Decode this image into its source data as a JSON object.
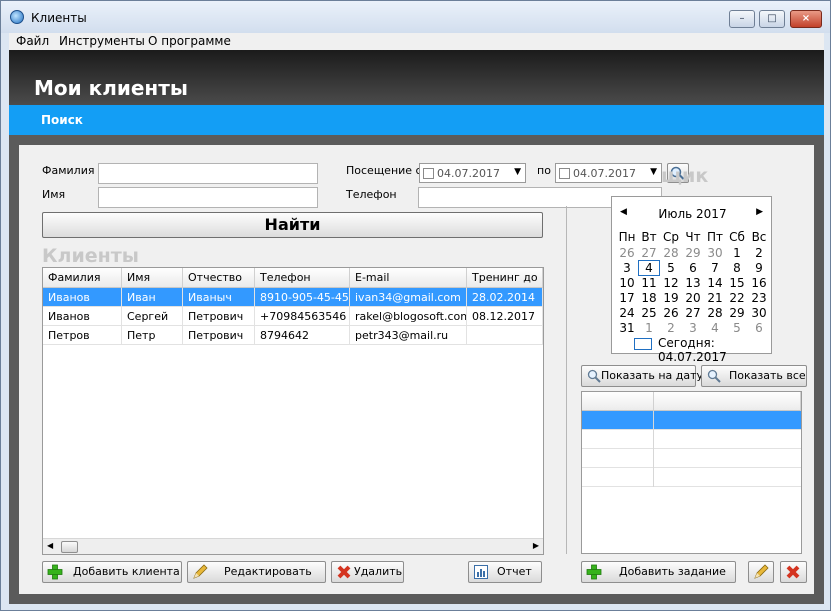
{
  "window": {
    "title": "Клиенты",
    "min": "–",
    "max": "□",
    "close": "×"
  },
  "menu": [
    "Файл",
    "Инструменты",
    "О программе"
  ],
  "header": {
    "title": "Мои клиенты",
    "tab": "Поиск"
  },
  "search": {
    "surname_label": "Фамилия",
    "name_label": "Имя",
    "visit_from_label": "Посещение с",
    "visit_to_label": "по",
    "phone_label": "Телефон",
    "date_from": "04.07.2017",
    "date_to": "04.07.2017",
    "find_button": "Найти"
  },
  "clients_section_title": "Клиенты",
  "scheduler_section_title": "щик",
  "table": {
    "columns": [
      "Фамилия",
      "Имя",
      "Отчество",
      "Телефон",
      "E-mail",
      "Тренинг до"
    ],
    "rows": [
      [
        "Иванов",
        "Иван",
        "Иваныч",
        "8910-905-45-45",
        "ivan34@gmail.com",
        "28.02.2014"
      ],
      [
        "Иванов",
        "Сергей",
        "Петрович",
        "+70984563546",
        "rakel@blogosoft.com",
        "08.12.2017"
      ],
      [
        "Петров",
        "Петр",
        "Петрович",
        "8794642",
        "petr343@mail.ru",
        ""
      ]
    ]
  },
  "buttons": {
    "add_client": "Добавить клиента",
    "edit": "Редактировать",
    "delete": "Удалить",
    "report": "Отчет",
    "show_on_date": "Показать на дату",
    "show_all": "Показать все",
    "add_task": "Добавить задание"
  },
  "calendar": {
    "month": "Июль 2017",
    "weekdays": [
      "Пн",
      "Вт",
      "Ср",
      "Чт",
      "Пт",
      "Сб",
      "Вс"
    ],
    "weeks": [
      [
        "26",
        "27",
        "28",
        "29",
        "30",
        "1",
        "2"
      ],
      [
        "3",
        "4",
        "5",
        "6",
        "7",
        "8",
        "9"
      ],
      [
        "10",
        "11",
        "12",
        "13",
        "14",
        "15",
        "16"
      ],
      [
        "17",
        "18",
        "19",
        "20",
        "21",
        "22",
        "23"
      ],
      [
        "24",
        "25",
        "26",
        "27",
        "28",
        "29",
        "30"
      ],
      [
        "31",
        "1",
        "2",
        "3",
        "4",
        "5",
        "6"
      ]
    ],
    "today": "Сегодня: 04.07.2017"
  },
  "colors": {
    "accent": "#139ef5",
    "selection": "#3399ff",
    "header_dark": "#2b2b2b"
  }
}
